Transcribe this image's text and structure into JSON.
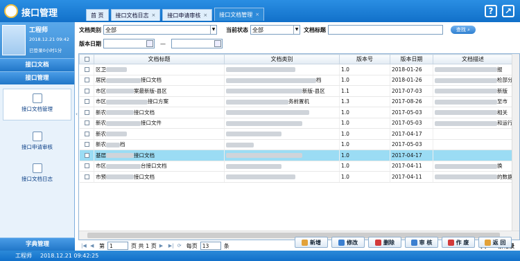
{
  "app": {
    "title": "接口管理"
  },
  "tabs": [
    {
      "label": "首 页",
      "closable": false
    },
    {
      "label": "接口文档日志",
      "closable": true
    },
    {
      "label": "接口申请审核",
      "closable": true
    },
    {
      "label": "接口文档管理",
      "closable": true
    }
  ],
  "tab_close": "×",
  "topicons": {
    "help": "?",
    "external": "↗"
  },
  "user": {
    "name": "工程师",
    "date": "2018.12.21 09:42",
    "login": "已登录0小时1分"
  },
  "sidebar": {
    "sections_top": [
      "接口文档",
      "接口管理"
    ],
    "items": [
      "接口文档管理",
      "接口申请审核",
      "接口文档日志"
    ],
    "section_bottom": "字典管理"
  },
  "filter": {
    "type_label": "文档类别",
    "type_value": "全部",
    "state_label": "当前状态",
    "state_value": "全部",
    "title_label": "文档标题",
    "title_value": "",
    "query_label": "查找",
    "date_label": "版本日期",
    "date_from": "",
    "date_sep": "—",
    "date_to": ""
  },
  "table": {
    "columns": [
      "",
      "文档标题",
      "文档类别",
      "版本号",
      "版本日期",
      "文档描述"
    ],
    "rows": [
      {
        "title": "区卫",
        "type": "区卫",
        "ver": "1.0",
        "date": "2018-01-26",
        "desc": "报"
      },
      {
        "title": "居民",
        "title2": "接口文档",
        "type2": "档",
        "ver": "1.0",
        "date": "2018-01-26",
        "desc": "检部分"
      },
      {
        "title": "市区",
        "title2": "案最新版-县区",
        "type2": "新版-县区",
        "ver": "1.1",
        "date": "2017-07-03",
        "desc": "新版"
      },
      {
        "title": "市区",
        "title2": "接口方案",
        "type2": "务前置机",
        "ver": "1.3",
        "date": "2017-08-26",
        "desc": "至市"
      },
      {
        "title": "新农",
        "title2": "接口文档",
        "type2": "",
        "ver": "1.0",
        "date": "2017-05-03",
        "desc": "相关"
      },
      {
        "title": "新农",
        "title2": "接口文件",
        "type2": "",
        "ver": "1.0",
        "date": "2017-05-03",
        "desc": "和运行"
      },
      {
        "title": "新农",
        "title2": "",
        "type2": "",
        "ver": "1.0",
        "date": "2017-04-17",
        "desc": ""
      },
      {
        "title": "新农",
        "title2": "档",
        "type2": "",
        "ver": "1.0",
        "date": "2017-05-03",
        "desc": ""
      },
      {
        "title": "基层",
        "title2": "接口文档",
        "type2": "",
        "ver": "1.0",
        "date": "2017-04-17",
        "desc": ""
      },
      {
        "title": "市区",
        "title2": "台接口文档",
        "type2": "",
        "ver": "1.0",
        "date": "2017-04-11",
        "desc": "换"
      },
      {
        "title": "市预",
        "title2": "接口文档",
        "type2": "",
        "ver": "1.0",
        "date": "2017-04-11",
        "desc": "的数据"
      }
    ],
    "highlighted_row": 8
  },
  "pager": {
    "page_prefix": "第",
    "page": "1",
    "page_suffix": "页 共 1 页",
    "per_page_label": "每页",
    "per_page": "13",
    "per_page_unit": "条",
    "total": "共 11 条记录"
  },
  "actions": [
    "新增",
    "修改",
    "删除",
    "审 核",
    "作 废",
    "返 回"
  ],
  "action_colors": [
    "#e2a23a",
    "#3b7fd0",
    "#d23a3a",
    "#3b7fd0",
    "#d23a3a",
    "#e2a23a"
  ],
  "status": {
    "user": "工程师",
    "time": "2018.12.21 09:42:25"
  }
}
